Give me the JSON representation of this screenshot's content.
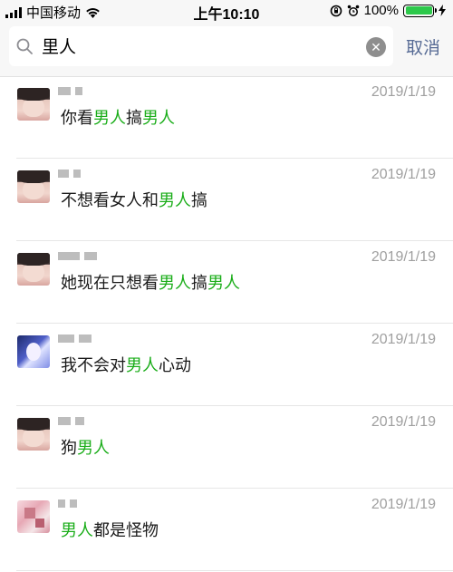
{
  "status_bar": {
    "carrier": "中国移动",
    "time": "上午10:10",
    "battery_percent": "100%",
    "battery_level": 1.0
  },
  "search": {
    "query": "里人",
    "cancel_label": "取消"
  },
  "results": [
    {
      "avatar": "avatar-girl",
      "date": "2019/1/19",
      "segments": [
        "你看",
        "男人",
        "搞",
        "男人",
        ""
      ]
    },
    {
      "avatar": "avatar-girl",
      "date": "2019/1/19",
      "segments": [
        "不想看女人和",
        "男人",
        "搞"
      ]
    },
    {
      "avatar": "avatar-girl",
      "date": "2019/1/19",
      "segments": [
        "她现在只想看",
        "男人",
        "搞",
        "男人",
        ""
      ]
    },
    {
      "avatar": "avatar-anime",
      "date": "2019/1/19",
      "segments": [
        "我不会对",
        "男人",
        "心动"
      ]
    },
    {
      "avatar": "avatar-girl",
      "date": "2019/1/19",
      "segments": [
        "狗",
        "男人",
        ""
      ]
    },
    {
      "avatar": "avatar-pink",
      "date": "2019/1/19",
      "segments": [
        "",
        "男人",
        "都是怪物"
      ]
    }
  ],
  "colors": {
    "highlight": "#1aad19",
    "cancel": "#576b95",
    "date": "#a0a0a0"
  }
}
